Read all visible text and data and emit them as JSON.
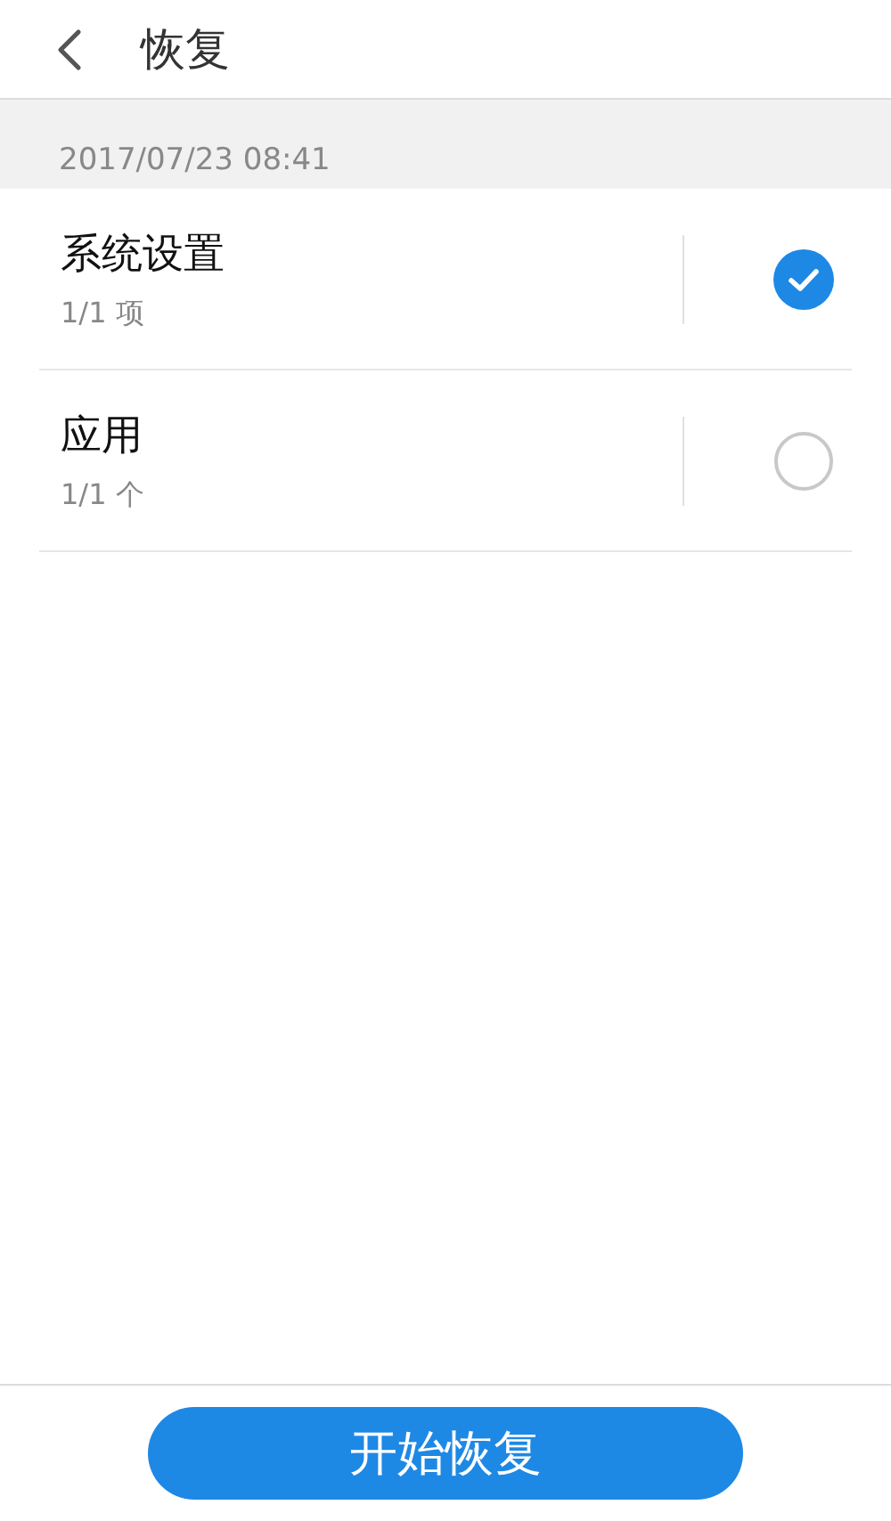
{
  "header": {
    "title": "恢复"
  },
  "backup_date": "2017/07/23 08:41",
  "items": [
    {
      "title": "系统设置",
      "count": "1/1 项",
      "checked": true
    },
    {
      "title": "应用",
      "count": "1/1 个",
      "checked": false
    }
  ],
  "action_button": {
    "label": "开始恢复"
  }
}
